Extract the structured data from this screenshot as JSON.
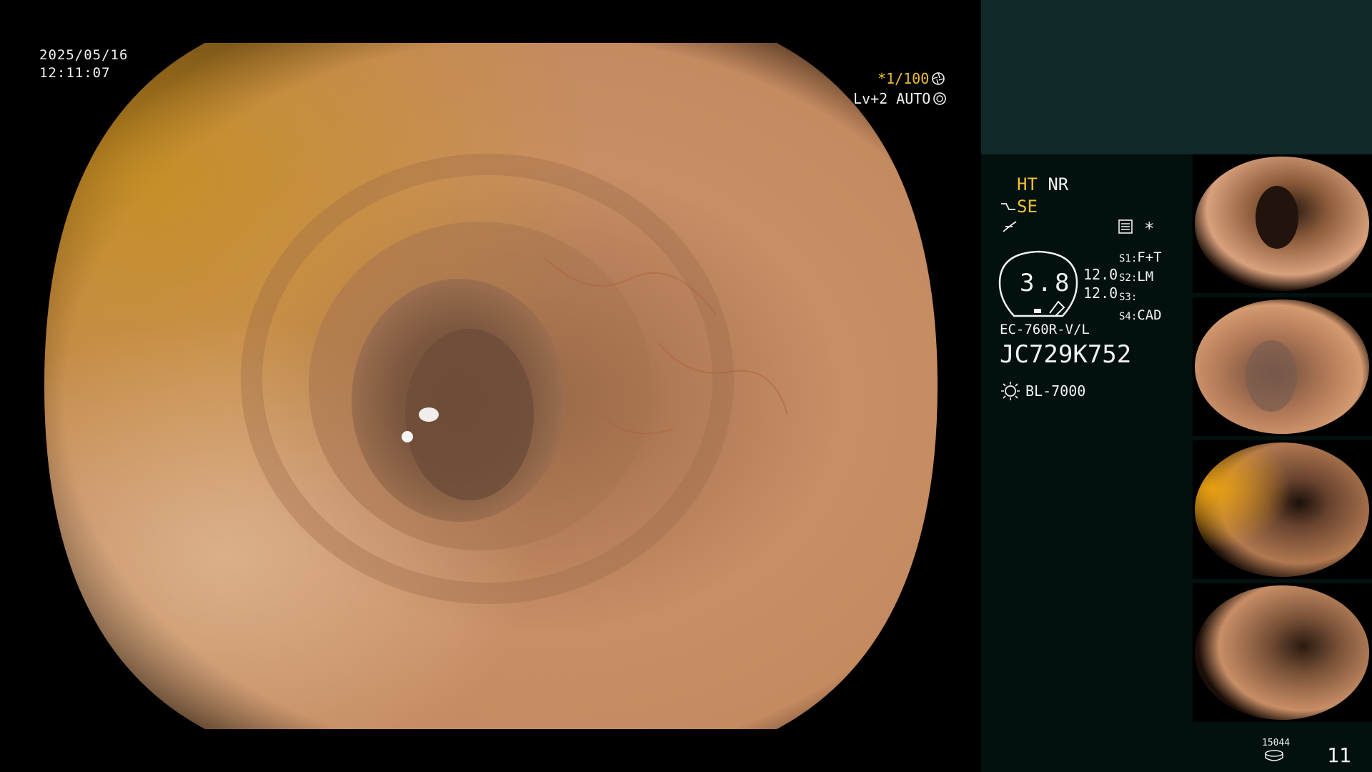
{
  "overlay": {
    "date": "2025/05/16",
    "time": "12:11:07",
    "shutter": "*1/100",
    "level": "Lv+2",
    "iris": "AUTO"
  },
  "panel": {
    "mode_ht": "HT",
    "mode_nr": "NR",
    "mode_se": "SE",
    "star": "*",
    "gauge_value": "3.8",
    "side_value_1": "12.0",
    "side_value_2": "12.0",
    "switches": [
      {
        "label": "S1:",
        "value": "F+T"
      },
      {
        "label": "S2:",
        "value": "LM"
      },
      {
        "label": "S3:",
        "value": ""
      },
      {
        "label": "S4:",
        "value": "CAD"
      }
    ],
    "scope_model": "EC-760R-V/L",
    "patient_id": "JC729K752",
    "light_source": "BL-7000",
    "counter_small": "15044",
    "image_count": "11"
  },
  "colors": {
    "accent_yellow": "#f0c030",
    "panel_bg": "#02100e",
    "panel_top": "#0f2a28"
  },
  "icons": {
    "shutter": "aperture-icon",
    "iris": "iris-icon",
    "enhance": "structure-enhance-icon",
    "color": "color-curve-icon",
    "memory": "memory-card-icon",
    "light": "sun-icon",
    "storage": "disk-icon"
  }
}
